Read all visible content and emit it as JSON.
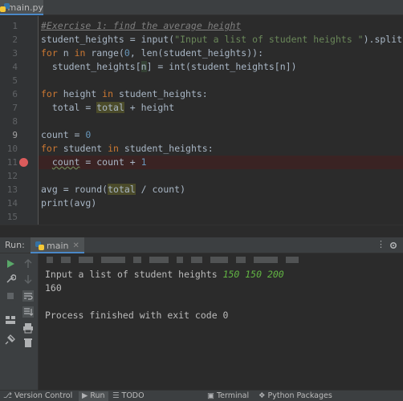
{
  "editor_tab": {
    "filename": "main.py"
  },
  "code": [
    {
      "n": "1",
      "tokens": [
        {
          "t": "#Exercise 1: find the average height",
          "c": "cm"
        }
      ]
    },
    {
      "n": "2",
      "tokens": [
        {
          "t": "student_heights = ",
          "c": ""
        },
        {
          "t": "input",
          "c": "fn"
        },
        {
          "t": "(",
          "c": ""
        },
        {
          "t": "\"Input a list of student heights \"",
          "c": "str"
        },
        {
          "t": ").split()",
          "c": ""
        }
      ]
    },
    {
      "n": "3",
      "tokens": [
        {
          "t": "for",
          "c": "kw"
        },
        {
          "t": " n ",
          "c": ""
        },
        {
          "t": "in",
          "c": "kw"
        },
        {
          "t": " range(",
          "c": ""
        },
        {
          "t": "0",
          "c": "num"
        },
        {
          "t": ", len(student_heights)):",
          "c": ""
        }
      ]
    },
    {
      "n": "4",
      "tokens": [
        {
          "t": "  student_heights[",
          "c": ""
        },
        {
          "t": "n",
          "c": "hl"
        },
        {
          "t": "] = int(student_heights[n])",
          "c": ""
        }
      ]
    },
    {
      "n": "5",
      "tokens": []
    },
    {
      "n": "6",
      "tokens": [
        {
          "t": "for",
          "c": "kw"
        },
        {
          "t": " height ",
          "c": ""
        },
        {
          "t": "in",
          "c": "kw"
        },
        {
          "t": " student_heights:",
          "c": ""
        }
      ]
    },
    {
      "n": "7",
      "tokens": [
        {
          "t": "  total",
          "c": ""
        },
        {
          "t": " = ",
          "c": ""
        },
        {
          "t": "total",
          "c": "hl2"
        },
        {
          "t": " + height",
          "c": ""
        }
      ]
    },
    {
      "n": "8",
      "tokens": []
    },
    {
      "n": "9",
      "tokens": [
        {
          "t": "count",
          "c": ""
        },
        {
          "t": " = ",
          "c": ""
        },
        {
          "t": "0",
          "c": "num"
        }
      ]
    },
    {
      "n": "10",
      "tokens": [
        {
          "t": "for",
          "c": "kw"
        },
        {
          "t": " student ",
          "c": ""
        },
        {
          "t": "in",
          "c": "kw"
        },
        {
          "t": " student_heights:",
          "c": ""
        }
      ]
    },
    {
      "n": "11",
      "tokens": [
        {
          "t": "  ",
          "c": ""
        },
        {
          "t": "count",
          "c": "under"
        },
        {
          "t": " = count + ",
          "c": ""
        },
        {
          "t": "1",
          "c": "num"
        }
      ],
      "breakpoint": true
    },
    {
      "n": "12",
      "tokens": []
    },
    {
      "n": "13",
      "tokens": [
        {
          "t": "avg = round(",
          "c": ""
        },
        {
          "t": "total",
          "c": "hl2"
        },
        {
          "t": " / count)",
          "c": ""
        }
      ]
    },
    {
      "n": "14",
      "tokens": [
        {
          "t": "print",
          "c": "fn"
        },
        {
          "t": "(avg)",
          "c": ""
        }
      ]
    },
    {
      "n": "15",
      "tokens": []
    }
  ],
  "run_panel": {
    "label": "Run:",
    "tab_label": "main"
  },
  "console": {
    "prompt": "Input a list of student heights ",
    "user_input": "150 150 200",
    "output": "160",
    "exit": "Process finished with exit code 0"
  },
  "statusbar": {
    "version_control": "Version Control",
    "run": "Run",
    "todo": "TODO",
    "terminal": "Terminal",
    "python_packages": "Python Packages"
  },
  "colors": {
    "keyword": "#cc7832",
    "string": "#6a8759",
    "number": "#6897bb",
    "comment": "#808080",
    "breakpoint": "#db5c5c",
    "accent": "#4a88c7"
  }
}
